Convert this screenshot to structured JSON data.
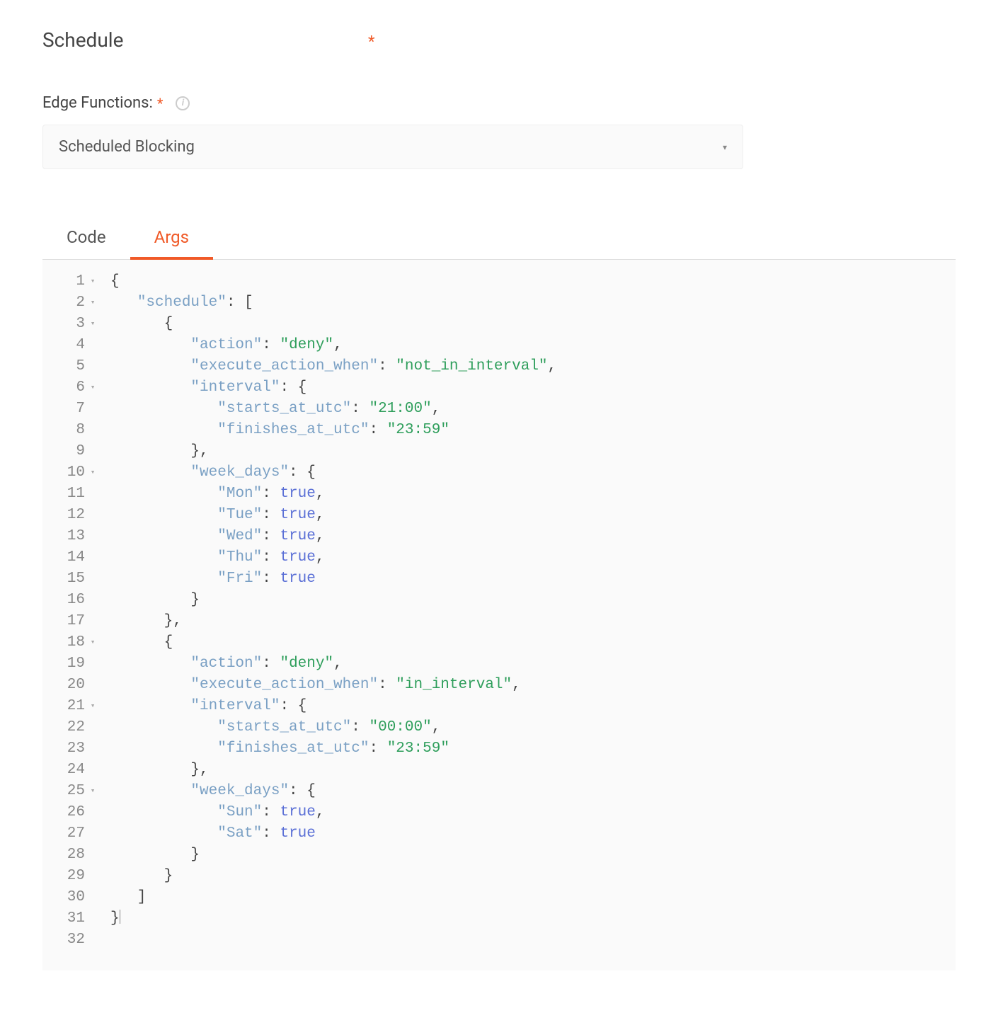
{
  "header": {
    "section_title": "Schedule",
    "required_mark": "*"
  },
  "field": {
    "label": "Edge Functions:",
    "required_mark": "*",
    "selected_value": "Scheduled Blocking"
  },
  "tabs": {
    "code_label": "Code",
    "args_label": "Args"
  },
  "editor": {
    "lines": [
      {
        "n": 1,
        "fold": true,
        "indent": 0,
        "tokens": [
          {
            "t": "brace",
            "v": "{"
          }
        ]
      },
      {
        "n": 2,
        "fold": true,
        "indent": 1,
        "tokens": [
          {
            "t": "key",
            "v": "\"schedule\""
          },
          {
            "t": "plain",
            "v": ": ["
          }
        ]
      },
      {
        "n": 3,
        "fold": true,
        "indent": 2,
        "tokens": [
          {
            "t": "brace",
            "v": "{"
          }
        ]
      },
      {
        "n": 4,
        "fold": false,
        "indent": 3,
        "tokens": [
          {
            "t": "key",
            "v": "\"action\""
          },
          {
            "t": "plain",
            "v": ": "
          },
          {
            "t": "str",
            "v": "\"deny\""
          },
          {
            "t": "plain",
            "v": ","
          }
        ]
      },
      {
        "n": 5,
        "fold": false,
        "indent": 3,
        "tokens": [
          {
            "t": "key",
            "v": "\"execute_action_when\""
          },
          {
            "t": "plain",
            "v": ": "
          },
          {
            "t": "str",
            "v": "\"not_in_interval\""
          },
          {
            "t": "plain",
            "v": ","
          }
        ]
      },
      {
        "n": 6,
        "fold": true,
        "indent": 3,
        "tokens": [
          {
            "t": "key",
            "v": "\"interval\""
          },
          {
            "t": "plain",
            "v": ": {"
          }
        ]
      },
      {
        "n": 7,
        "fold": false,
        "indent": 4,
        "tokens": [
          {
            "t": "key",
            "v": "\"starts_at_utc\""
          },
          {
            "t": "plain",
            "v": ": "
          },
          {
            "t": "str",
            "v": "\"21:00\""
          },
          {
            "t": "plain",
            "v": ","
          }
        ]
      },
      {
        "n": 8,
        "fold": false,
        "indent": 4,
        "tokens": [
          {
            "t": "key",
            "v": "\"finishes_at_utc\""
          },
          {
            "t": "plain",
            "v": ": "
          },
          {
            "t": "str",
            "v": "\"23:59\""
          }
        ]
      },
      {
        "n": 9,
        "fold": false,
        "indent": 3,
        "tokens": [
          {
            "t": "plain",
            "v": "},"
          }
        ]
      },
      {
        "n": 10,
        "fold": true,
        "indent": 3,
        "tokens": [
          {
            "t": "key",
            "v": "\"week_days\""
          },
          {
            "t": "plain",
            "v": ": {"
          }
        ]
      },
      {
        "n": 11,
        "fold": false,
        "indent": 4,
        "tokens": [
          {
            "t": "key",
            "v": "\"Mon\""
          },
          {
            "t": "plain",
            "v": ": "
          },
          {
            "t": "bool",
            "v": "true"
          },
          {
            "t": "plain",
            "v": ","
          }
        ]
      },
      {
        "n": 12,
        "fold": false,
        "indent": 4,
        "tokens": [
          {
            "t": "key",
            "v": "\"Tue\""
          },
          {
            "t": "plain",
            "v": ": "
          },
          {
            "t": "bool",
            "v": "true"
          },
          {
            "t": "plain",
            "v": ","
          }
        ]
      },
      {
        "n": 13,
        "fold": false,
        "indent": 4,
        "tokens": [
          {
            "t": "key",
            "v": "\"Wed\""
          },
          {
            "t": "plain",
            "v": ": "
          },
          {
            "t": "bool",
            "v": "true"
          },
          {
            "t": "plain",
            "v": ","
          }
        ]
      },
      {
        "n": 14,
        "fold": false,
        "indent": 4,
        "tokens": [
          {
            "t": "key",
            "v": "\"Thu\""
          },
          {
            "t": "plain",
            "v": ": "
          },
          {
            "t": "bool",
            "v": "true"
          },
          {
            "t": "plain",
            "v": ","
          }
        ]
      },
      {
        "n": 15,
        "fold": false,
        "indent": 4,
        "tokens": [
          {
            "t": "key",
            "v": "\"Fri\""
          },
          {
            "t": "plain",
            "v": ": "
          },
          {
            "t": "bool",
            "v": "true"
          }
        ]
      },
      {
        "n": 16,
        "fold": false,
        "indent": 3,
        "tokens": [
          {
            "t": "plain",
            "v": "}"
          }
        ]
      },
      {
        "n": 17,
        "fold": false,
        "indent": 2,
        "tokens": [
          {
            "t": "plain",
            "v": "},"
          }
        ]
      },
      {
        "n": 18,
        "fold": true,
        "indent": 2,
        "tokens": [
          {
            "t": "brace",
            "v": "{"
          }
        ]
      },
      {
        "n": 19,
        "fold": false,
        "indent": 3,
        "tokens": [
          {
            "t": "key",
            "v": "\"action\""
          },
          {
            "t": "plain",
            "v": ": "
          },
          {
            "t": "str",
            "v": "\"deny\""
          },
          {
            "t": "plain",
            "v": ","
          }
        ]
      },
      {
        "n": 20,
        "fold": false,
        "indent": 3,
        "tokens": [
          {
            "t": "key",
            "v": "\"execute_action_when\""
          },
          {
            "t": "plain",
            "v": ": "
          },
          {
            "t": "str",
            "v": "\"in_interval\""
          },
          {
            "t": "plain",
            "v": ","
          }
        ]
      },
      {
        "n": 21,
        "fold": true,
        "indent": 3,
        "tokens": [
          {
            "t": "key",
            "v": "\"interval\""
          },
          {
            "t": "plain",
            "v": ": {"
          }
        ]
      },
      {
        "n": 22,
        "fold": false,
        "indent": 4,
        "tokens": [
          {
            "t": "key",
            "v": "\"starts_at_utc\""
          },
          {
            "t": "plain",
            "v": ": "
          },
          {
            "t": "str",
            "v": "\"00:00\""
          },
          {
            "t": "plain",
            "v": ","
          }
        ]
      },
      {
        "n": 23,
        "fold": false,
        "indent": 4,
        "tokens": [
          {
            "t": "key",
            "v": "\"finishes_at_utc\""
          },
          {
            "t": "plain",
            "v": ": "
          },
          {
            "t": "str",
            "v": "\"23:59\""
          }
        ]
      },
      {
        "n": 24,
        "fold": false,
        "indent": 3,
        "tokens": [
          {
            "t": "plain",
            "v": "},"
          }
        ]
      },
      {
        "n": 25,
        "fold": true,
        "indent": 3,
        "tokens": [
          {
            "t": "key",
            "v": "\"week_days\""
          },
          {
            "t": "plain",
            "v": ": {"
          }
        ]
      },
      {
        "n": 26,
        "fold": false,
        "indent": 4,
        "tokens": [
          {
            "t": "key",
            "v": "\"Sun\""
          },
          {
            "t": "plain",
            "v": ": "
          },
          {
            "t": "bool",
            "v": "true"
          },
          {
            "t": "plain",
            "v": ","
          }
        ]
      },
      {
        "n": 27,
        "fold": false,
        "indent": 4,
        "tokens": [
          {
            "t": "key",
            "v": "\"Sat\""
          },
          {
            "t": "plain",
            "v": ": "
          },
          {
            "t": "bool",
            "v": "true"
          }
        ]
      },
      {
        "n": 28,
        "fold": false,
        "indent": 3,
        "tokens": [
          {
            "t": "plain",
            "v": "}"
          }
        ]
      },
      {
        "n": 29,
        "fold": false,
        "indent": 2,
        "tokens": [
          {
            "t": "plain",
            "v": "}"
          }
        ]
      },
      {
        "n": 30,
        "fold": false,
        "indent": 1,
        "tokens": [
          {
            "t": "plain",
            "v": "]"
          }
        ]
      },
      {
        "n": 31,
        "fold": false,
        "indent": 0,
        "tokens": [
          {
            "t": "brace",
            "v": "}"
          }
        ],
        "cursor_after": true
      },
      {
        "n": 32,
        "fold": false,
        "indent": 0,
        "tokens": []
      }
    ]
  }
}
